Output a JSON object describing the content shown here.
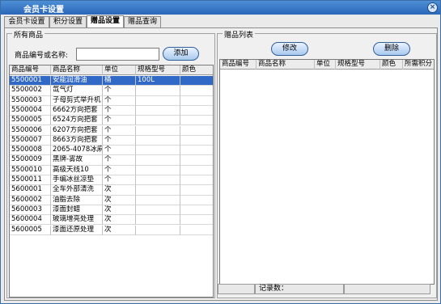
{
  "window": {
    "title": "会员卡设置",
    "close_glyph": "×"
  },
  "tabs": [
    {
      "label": "会员卡设置",
      "active": false
    },
    {
      "label": "积分设置",
      "active": false
    },
    {
      "label": "赠品设置",
      "active": true
    },
    {
      "label": "赠品查询",
      "active": false
    }
  ],
  "left_panel": {
    "group_title": "所有商品",
    "search_label": "商品编号或名称:",
    "search_value": "",
    "add_button": "添加",
    "columns": [
      "商品编号",
      "商品名称",
      "单位",
      "规格型号",
      "颜色"
    ],
    "rows": [
      {
        "code": "5500001",
        "name": "安能润滑油",
        "unit": "桶",
        "spec": "100L",
        "color": "",
        "selected": true
      },
      {
        "code": "5500002",
        "name": "氙气灯",
        "unit": "个",
        "spec": "",
        "color": "",
        "selected": false
      },
      {
        "code": "5500003",
        "name": "子母剪式举升机",
        "unit": "个",
        "spec": "",
        "color": "",
        "selected": false
      },
      {
        "code": "5500004",
        "name": "6662方向把套",
        "unit": "个",
        "spec": "",
        "color": "",
        "selected": false
      },
      {
        "code": "5500005",
        "name": "6524方向把套",
        "unit": "个",
        "spec": "",
        "color": "",
        "selected": false
      },
      {
        "code": "5500006",
        "name": "6207方向把套",
        "unit": "个",
        "spec": "",
        "color": "",
        "selected": false
      },
      {
        "code": "5500007",
        "name": "8663方向把套",
        "unit": "个",
        "spec": "",
        "color": "",
        "selected": false
      },
      {
        "code": "5500008",
        "name": "2065-4078冰麻垫",
        "unit": "个",
        "spec": "",
        "color": "",
        "selected": false
      },
      {
        "code": "5500009",
        "name": "黑牌-雾故",
        "unit": "个",
        "spec": "",
        "color": "",
        "selected": false
      },
      {
        "code": "5500010",
        "name": "高级天线10",
        "unit": "个",
        "spec": "",
        "color": "",
        "selected": false
      },
      {
        "code": "5500011",
        "name": "手编冰丝凉垫",
        "unit": "个",
        "spec": "",
        "color": "",
        "selected": false
      },
      {
        "code": "5600001",
        "name": "全车外部清洗",
        "unit": "次",
        "spec": "",
        "color": "",
        "selected": false
      },
      {
        "code": "5600002",
        "name": "油脂去除",
        "unit": "次",
        "spec": "",
        "color": "",
        "selected": false
      },
      {
        "code": "5600003",
        "name": "漆面封蜡",
        "unit": "次",
        "spec": "",
        "color": "",
        "selected": false
      },
      {
        "code": "5600004",
        "name": "玻璃增亮处理",
        "unit": "次",
        "spec": "",
        "color": "",
        "selected": false
      },
      {
        "code": "5600005",
        "name": "漆面还原处理",
        "unit": "次",
        "spec": "",
        "color": "",
        "selected": false
      }
    ]
  },
  "right_panel": {
    "group_title": "赠品列表",
    "modify_button": "修改",
    "delete_button": "删除",
    "columns": [
      "商品编号",
      "商品名称",
      "单位",
      "规格型号",
      "颜色",
      "所需积分"
    ],
    "record_count_label": "记录数："
  },
  "colors": {
    "selection": "#3169c6",
    "titlebar": "#2b66b8"
  }
}
